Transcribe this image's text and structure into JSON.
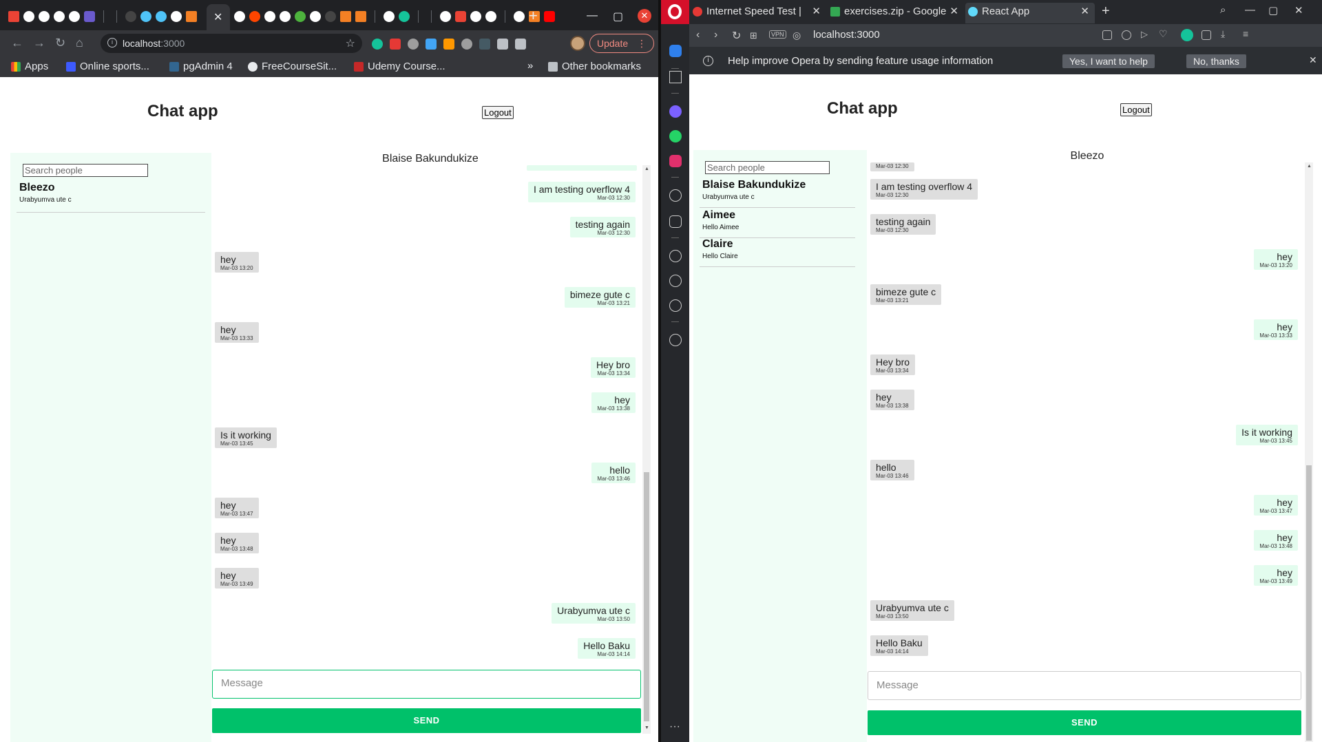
{
  "chrome": {
    "url_host": "localhost",
    "url_port": ":3000",
    "update_label": "Update",
    "bookmarks": [
      {
        "label": "Apps",
        "color": "#ff6d00"
      },
      {
        "label": "Online sports...",
        "color": "#3d5afe"
      },
      {
        "label": "pgAdmin 4",
        "color": "#326690"
      },
      {
        "label": "FreeCourseSit...",
        "color": "#e8eaed"
      },
      {
        "label": "Udemy Course...",
        "color": "#c62828"
      }
    ],
    "bookmarks_more": "»",
    "other_bookmarks": "Other bookmarks",
    "app": {
      "title": "Chat app",
      "logout": "Logout",
      "search_placeholder": "Search people",
      "contacts": [
        {
          "name": "Bleezo",
          "preview": "Urabyumva ute c"
        }
      ],
      "chat_header": "Blaise Bakundukize",
      "messages": [
        {
          "text": "I am testing overflow 4",
          "time": "Mar-03 12:30",
          "dir": "sent"
        },
        {
          "text": "testing again",
          "time": "Mar-03 12:30",
          "dir": "sent"
        },
        {
          "text": "hey",
          "time": "Mar-03 13:20",
          "dir": "recv"
        },
        {
          "text": "bimeze gute c",
          "time": "Mar-03 13:21",
          "dir": "sent"
        },
        {
          "text": "hey",
          "time": "Mar-03 13:33",
          "dir": "recv"
        },
        {
          "text": "Hey bro",
          "time": "Mar-03 13:34",
          "dir": "sent"
        },
        {
          "text": "hey",
          "time": "Mar-03 13:38",
          "dir": "sent"
        },
        {
          "text": "Is it working",
          "time": "Mar-03 13:45",
          "dir": "recv"
        },
        {
          "text": "hello",
          "time": "Mar-03 13:46",
          "dir": "sent"
        },
        {
          "text": "hey",
          "time": "Mar-03 13:47",
          "dir": "recv"
        },
        {
          "text": "hey",
          "time": "Mar-03 13:48",
          "dir": "recv"
        },
        {
          "text": "hey",
          "time": "Mar-03 13:49",
          "dir": "recv"
        },
        {
          "text": "Urabyumva ute c",
          "time": "Mar-03 13:50",
          "dir": "sent"
        },
        {
          "text": "Hello Baku",
          "time": "Mar-03 14:14",
          "dir": "sent"
        }
      ],
      "message_placeholder": "Message",
      "send_label": "SEND"
    }
  },
  "opera": {
    "tabs": [
      {
        "label": "Internet Speed Test |",
        "color": "#e53935"
      },
      {
        "label": "exercises.zip - Google",
        "color": "#34a853"
      },
      {
        "label": "React App",
        "color": "#61dafb"
      }
    ],
    "new_tab": "+",
    "vpn_label": "VPN",
    "url": "localhost:3000",
    "infobar": {
      "text": "Help improve Opera by sending feature usage information",
      "yes": "Yes, I want to help",
      "no": "No, thanks"
    },
    "app": {
      "title": "Chat app",
      "logout": "Logout",
      "search_placeholder": "Search people",
      "contacts": [
        {
          "name": "Blaise Bakundukize",
          "preview": "Urabyumva ute c"
        },
        {
          "name": "Aimee",
          "preview": "Hello Aimee"
        },
        {
          "name": "Claire",
          "preview": "Hello Claire"
        }
      ],
      "chat_header": "Bleezo",
      "messages": [
        {
          "text": "I am testing overflow 4",
          "time": "Mar-03 12:30",
          "dir": "recv"
        },
        {
          "text": "testing again",
          "time": "Mar-03 12:30",
          "dir": "recv"
        },
        {
          "text": "hey",
          "time": "Mar-03 13:20",
          "dir": "sent"
        },
        {
          "text": "bimeze gute c",
          "time": "Mar-03 13:21",
          "dir": "recv"
        },
        {
          "text": "hey",
          "time": "Mar-03 13:33",
          "dir": "sent"
        },
        {
          "text": "Hey bro",
          "time": "Mar-03 13:34",
          "dir": "recv"
        },
        {
          "text": "hey",
          "time": "Mar-03 13:38",
          "dir": "recv"
        },
        {
          "text": "Is it working",
          "time": "Mar-03 13:45",
          "dir": "sent"
        },
        {
          "text": "hello",
          "time": "Mar-03 13:46",
          "dir": "recv"
        },
        {
          "text": "hey",
          "time": "Mar-03 13:47",
          "dir": "sent"
        },
        {
          "text": "hey",
          "time": "Mar-03 13:48",
          "dir": "sent"
        },
        {
          "text": "hey",
          "time": "Mar-03 13:49",
          "dir": "sent"
        },
        {
          "text": "Urabyumva ute c",
          "time": "Mar-03 13:50",
          "dir": "recv"
        },
        {
          "text": "Hello Baku",
          "time": "Mar-03 14:14",
          "dir": "recv"
        }
      ],
      "message_placeholder": "Message",
      "send_label": "SEND"
    }
  },
  "colors": {
    "send_green": "#00c16a",
    "sent_bubble": "#e3fcee",
    "recv_bubble": "#dedede",
    "sidebar_bg": "#f0fdf6",
    "opera_red": "#d5102a"
  }
}
